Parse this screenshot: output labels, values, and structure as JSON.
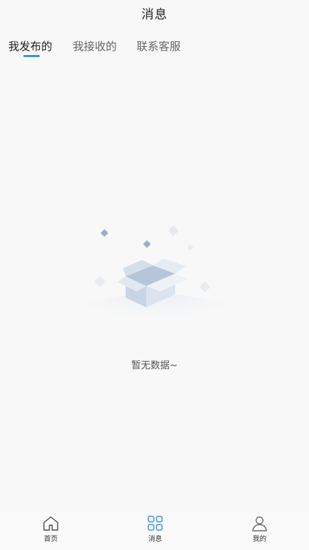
{
  "header": {
    "title": "消息"
  },
  "tabs": [
    {
      "label": "我发布的",
      "active": true
    },
    {
      "label": "我接收的",
      "active": false
    },
    {
      "label": "联系客服",
      "active": false
    }
  ],
  "accent_color": "#3a8ee6",
  "empty_state": {
    "icon": "empty-box-icon",
    "text": "暂无数据~"
  },
  "bottom_nav": [
    {
      "label": "首页",
      "icon": "home-icon",
      "active": false
    },
    {
      "label": "消息",
      "icon": "grid-icon",
      "active": true
    },
    {
      "label": "我的",
      "icon": "user-icon",
      "active": false
    }
  ]
}
